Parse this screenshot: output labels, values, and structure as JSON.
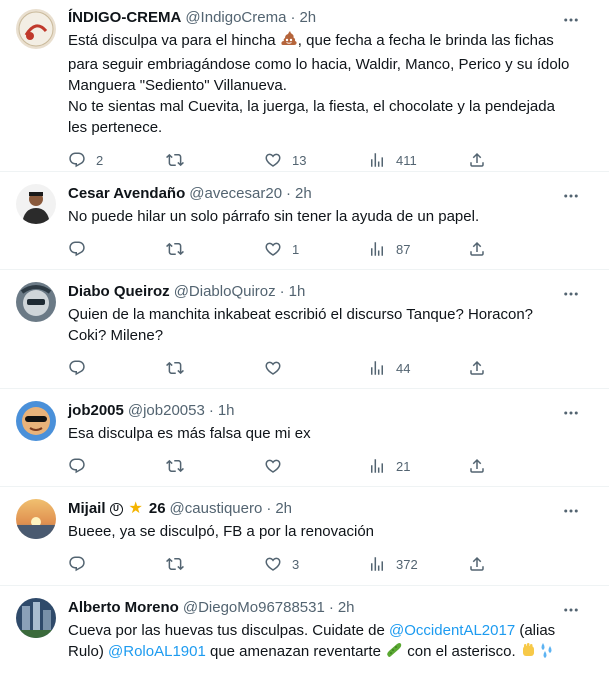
{
  "tweets": [
    {
      "name": "ÍNDIGO-CREMA",
      "handle": "@IndigoCrema",
      "dot": "·",
      "time": "2h",
      "text_a": "Está disculpa va para el hincha ",
      "text_b": ", que fecha a fecha le brinda las fichas\npara seguir embriagándose como lo hacia, Waldir, Manco, Perico y su ídolo\nManguera \"Sediento\" Villanueva.\nNo te sientas mal Cuevita, la juerga, la fiesta, el chocolate y la pendejada\nles pertenece.",
      "replies": "2",
      "retweets": "",
      "likes": "13",
      "views": "411"
    },
    {
      "name": "Cesar Avendaño",
      "handle": "@avecesar20",
      "dot": "·",
      "time": "2h",
      "text": "No puede hilar un solo párrafo sin tener la ayuda de un papel.",
      "replies": "",
      "retweets": "",
      "likes": "1",
      "views": "87"
    },
    {
      "name": "Diabo Queiroz",
      "handle": "@DiabloQuiroz",
      "dot": "·",
      "time": "1h",
      "text": "Quien de la manchita inkabeat escribió el discurso Tanque? Horacon?\nCoki? Milene?",
      "replies": "",
      "retweets": "",
      "likes": "",
      "views": "44"
    },
    {
      "name": "job2005",
      "handle": "@job20053",
      "dot": "·",
      "time": "1h",
      "text": "Esa disculpa es más falsa que mi ex",
      "replies": "",
      "retweets": "",
      "likes": "",
      "views": "21"
    },
    {
      "name": "Mijail",
      "badge_letter": "U",
      "badge_number": "26",
      "handle": "@caustiquero",
      "dot": "·",
      "time": "2h",
      "text": "Bueee, ya se disculpó, FB a por la renovación",
      "replies": "",
      "retweets": "",
      "likes": "3",
      "views": "372"
    },
    {
      "name": "Alberto Moreno",
      "handle": "@DiegoMo96788531",
      "dot": "·",
      "time": "2h",
      "text_a": "Cueva por las huevas tus disculpas. Cuidate de ",
      "mention1": "@OccidentAL2017",
      "text_b": " (alias\nRulo) ",
      "mention2": "@RoloAL1901",
      "text_c": " que amenazan reventarte ",
      "text_d": " con el asterisco. "
    }
  ],
  "colors": {
    "text": "#0f1419",
    "secondary": "#536471",
    "link": "#1d9bf0",
    "divider": "#eff3f4"
  },
  "icons": [
    "more-icon",
    "reply-icon",
    "retweet-icon",
    "like-icon",
    "views-icon",
    "share-icon"
  ]
}
